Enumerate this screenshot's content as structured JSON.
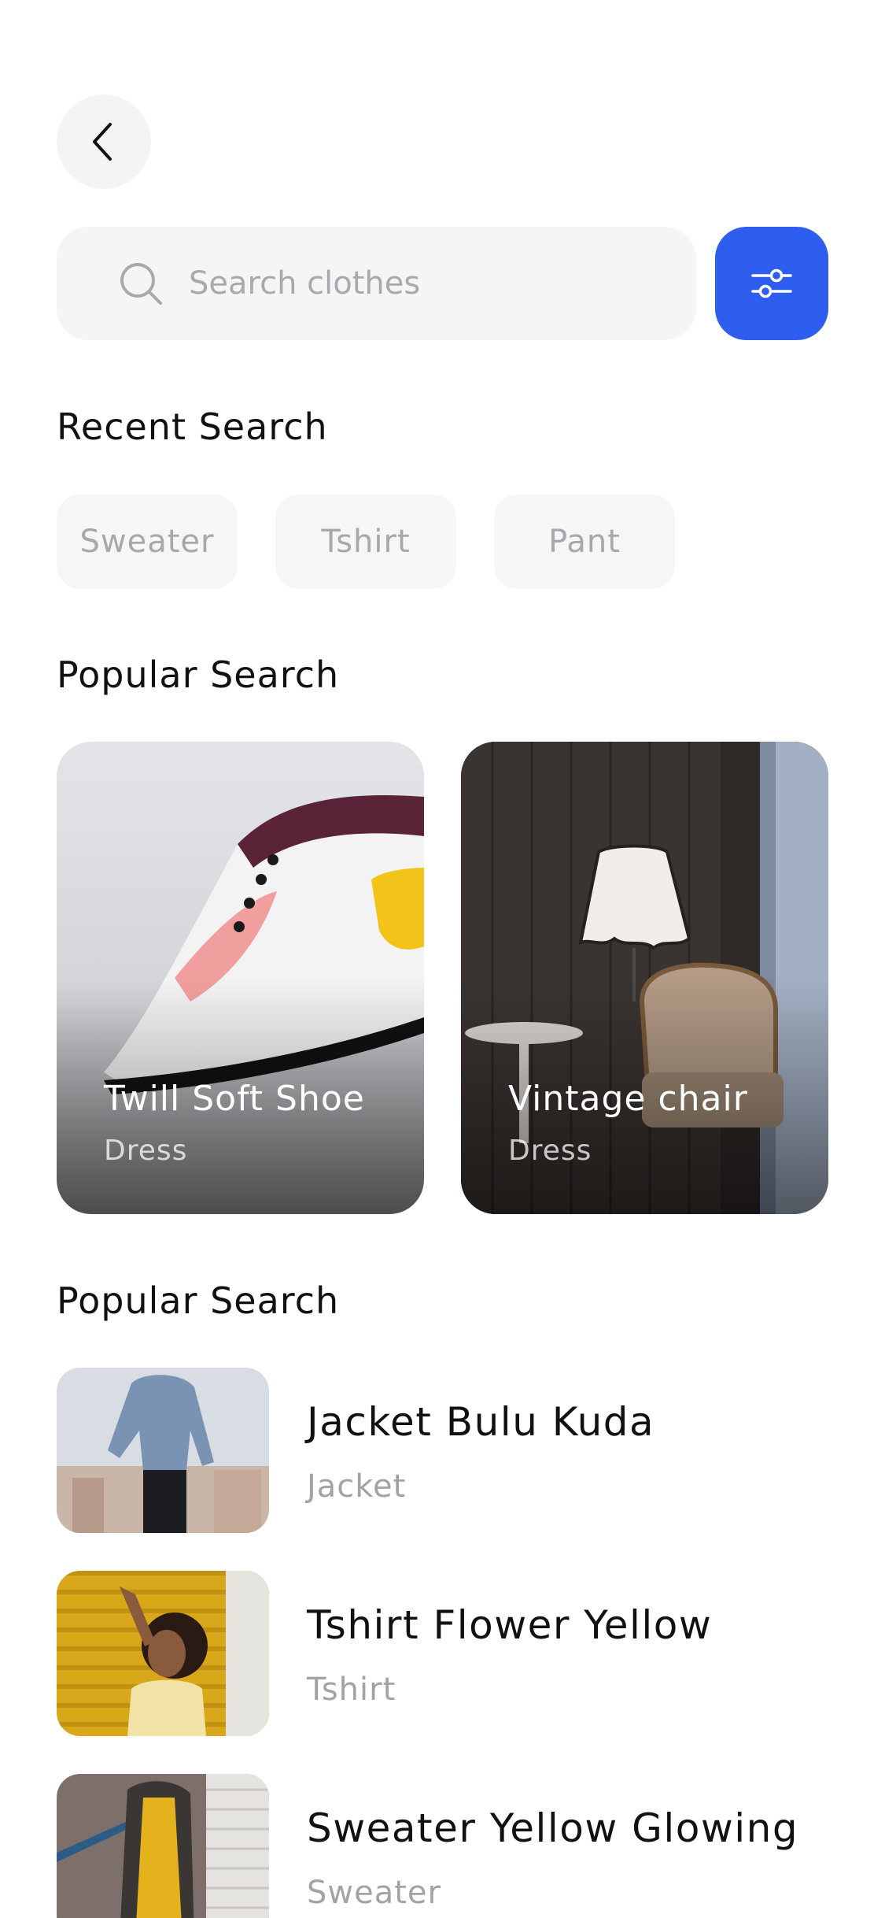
{
  "search": {
    "placeholder": "Search clothes"
  },
  "recent": {
    "title": "Recent Search",
    "chips": [
      "Sweater",
      "Tshirt",
      "Pant"
    ]
  },
  "popular_cards": {
    "title": "Popular Search",
    "cards": [
      {
        "title": "Twill Soft Shoe",
        "subtitle": "Dress"
      },
      {
        "title": "Vintage chair",
        "subtitle": "Dress"
      }
    ]
  },
  "popular_list": {
    "title": "Popular Search",
    "items": [
      {
        "title": "Jacket Bulu Kuda",
        "subtitle": "Jacket"
      },
      {
        "title": "Tshirt Flower Yellow",
        "subtitle": "Tshirt"
      },
      {
        "title": "Sweater Yellow Glowing",
        "subtitle": "Sweater"
      }
    ]
  },
  "icons": {
    "back": "chevron-left-icon",
    "search": "search-icon",
    "filter": "sliders-icon"
  },
  "colors": {
    "accent": "#2d5ef0",
    "chip_bg": "#f6f6f7",
    "muted_text": "#a8a8ac"
  }
}
